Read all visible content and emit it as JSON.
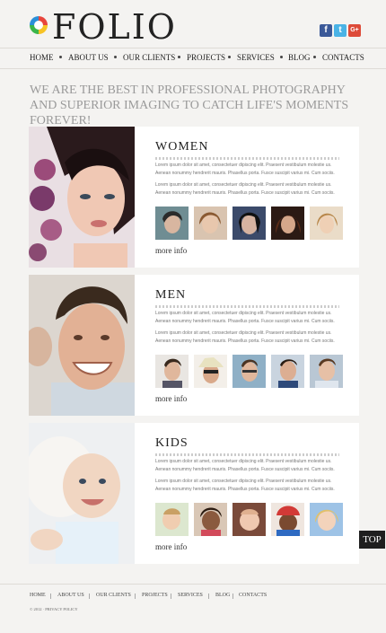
{
  "brand": {
    "name": "FOLIO"
  },
  "social": {
    "facebook": "f",
    "twitter": "t",
    "google": "G+"
  },
  "nav": [
    "HOME",
    "ABOUT US",
    "OUR CLIENTS",
    "PROJECTS",
    "SERVICES",
    "BLOG",
    "CONTACTS"
  ],
  "headline": "WE ARE THE BEST IN PROFESSIONAL PHOTOGRAPHY AND SUPERIOR IMAGING TO CATCH LIFE'S MOMENTS FOREVER!",
  "sections": [
    {
      "title": "WOMEN",
      "para1": "Lorem ipsum dolor sit amet, consectetuer dipiscing elit. Praesent vestibulum molestie us. Aenean nonummy hendrerit mauris. Phasellus porta. Fusce suscipit varius mi. Cum sociis.",
      "para2": "Lorem ipsum dolor sit amet, consectetuer dipiscing elit. Praesent vestibulum molestie us. Aenean nonummy hendrerit mauris. Phasellus porta. Fusce suscipit varius mi. Cum sociis.",
      "more": "more info"
    },
    {
      "title": "MEN",
      "para1": "Lorem ipsum dolor sit amet, consectetuer dipiscing elit. Praesent vestibulum molestie us. Aenean nonummy hendrerit mauris. Phasellus porta. Fusce suscipit varius mi. Cum sociis.",
      "para2": "Lorem ipsum dolor sit amet, consectetuer dipiscing elit. Praesent vestibulum molestie us. Aenean nonummy hendrerit mauris. Phasellus porta. Fusce suscipit varius mi. Cum sociis.",
      "more": "more info"
    },
    {
      "title": "KIDS",
      "para1": "Lorem ipsum dolor sit amet, consectetuer dipiscing elit. Praesent vestibulum molestie us. Aenean nonummy hendrerit mauris. Phasellus porta. Fusce suscipit varius mi. Cum sociis.",
      "para2": "Lorem ipsum dolor sit amet, consectetuer dipiscing elit. Praesent vestibulum molestie us. Aenean nonummy hendrerit mauris. Phasellus porta. Fusce suscipit varius mi. Cum sociis.",
      "more": "more info"
    }
  ],
  "top_button": "TOP",
  "footer": {
    "nav": [
      "HOME",
      "ABOUT US",
      "OUR CLIENTS",
      "PROJECTS",
      "SERVICES",
      "BLOG",
      "CONTACTS"
    ],
    "copyright": "© 2012 · PRIVACY POLICY"
  }
}
